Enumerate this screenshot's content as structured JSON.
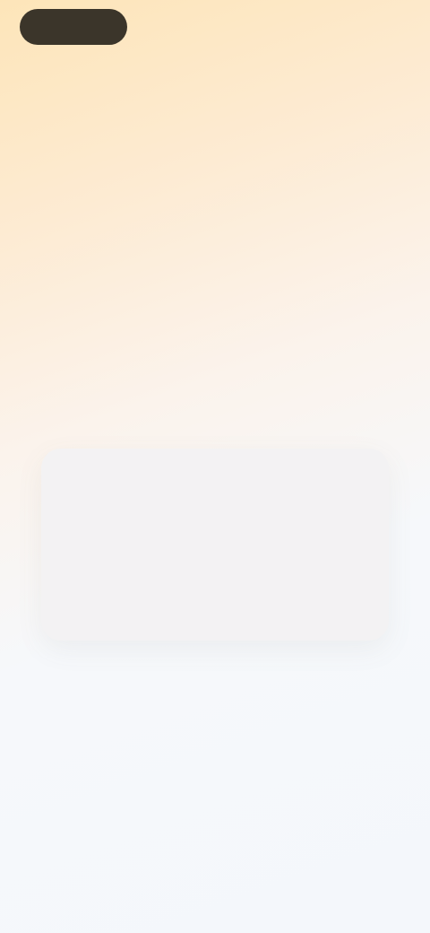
{
  "header": {
    "logo_label": "",
    "right_link": ""
  },
  "hero": {
    "title": "",
    "subtitle": ""
  },
  "card": {
    "eyebrow": "",
    "text": "",
    "chips": [
      "",
      "",
      ""
    ]
  },
  "colors": {
    "logo_bg": "#3b352a",
    "title": "#4a4640",
    "subtitle": "#7d7a76",
    "card_bg": "#f3f2f3",
    "chip_1": "#e5b7b1",
    "chip_2": "#a9d7cf",
    "chip_3": "#e3b7b4"
  }
}
